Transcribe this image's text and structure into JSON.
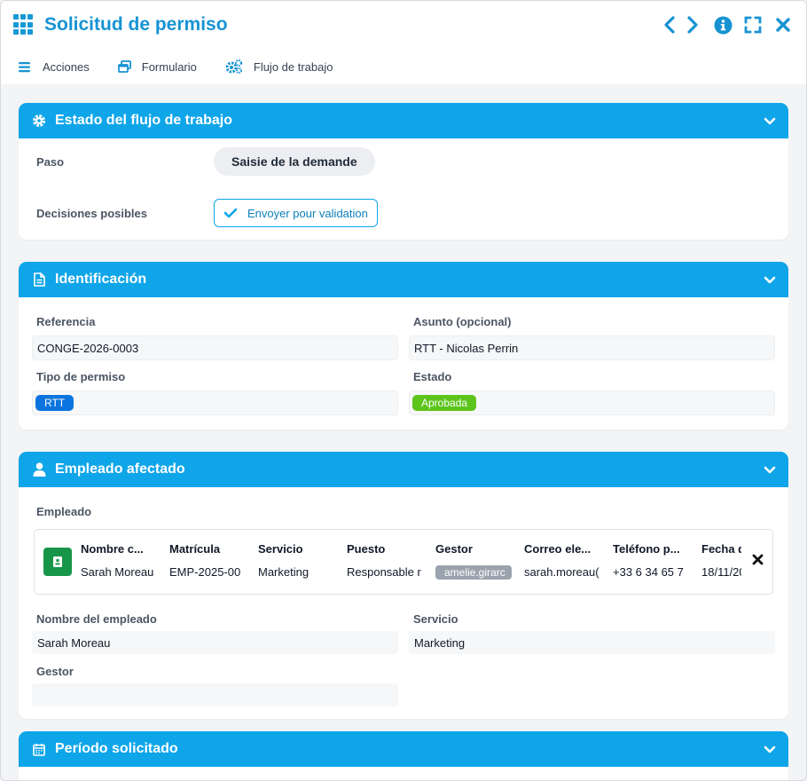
{
  "window": {
    "title": "Solicitud de permiso"
  },
  "toolbar": {
    "actions_label": "Acciones",
    "form_label": "Formulario",
    "workflow_label": "Flujo de trabajo"
  },
  "workflow_panel": {
    "title": "Estado del flujo de trabajo",
    "step_label": "Paso",
    "step_value": "Saisie de la demande",
    "decisions_label": "Decisiones posibles",
    "decision_button": "Envoyer pour validation"
  },
  "identification": {
    "title": "Identificación",
    "reference_label": "Referencia",
    "reference_value": "CONGE-2026-0003",
    "subject_label": "Asunto (opcional)",
    "subject_value": "RTT - Nicolas Perrin",
    "leave_type_label": "Tipo de permiso",
    "leave_type_value": "RTT",
    "leave_type_color": "#0b74de",
    "status_label": "Estado",
    "status_value": "Aprobada",
    "status_color": "#5cc41a"
  },
  "employee": {
    "title": "Empleado afectado",
    "employee_label": "Empleado",
    "card": {
      "columns": [
        {
          "header": "Nombre c...",
          "value": "Sarah Moreau"
        },
        {
          "header": "Matrícula",
          "value": "EMP-2025-00"
        },
        {
          "header": "Servicio",
          "value": "Marketing"
        },
        {
          "header": "Puesto",
          "value": "Responsable r"
        },
        {
          "header": "Gestor",
          "value": "amelie.girarc"
        },
        {
          "header": "Correo ele...",
          "value": "sarah.moreau("
        },
        {
          "header": "Teléfono p...",
          "value": "+33 6 34 65 7"
        },
        {
          "header": "Fecha d",
          "value": "18/11/20"
        }
      ]
    },
    "name_label": "Nombre del empleado",
    "name_value": "Sarah Moreau",
    "service_label": "Servicio",
    "service_value": "Marketing",
    "manager_label": "Gestor",
    "manager_value": ""
  },
  "period": {
    "title": "Período solicitado"
  },
  "colors": {
    "accent": "#0ea5e9",
    "title_blue": "#1793d3"
  }
}
